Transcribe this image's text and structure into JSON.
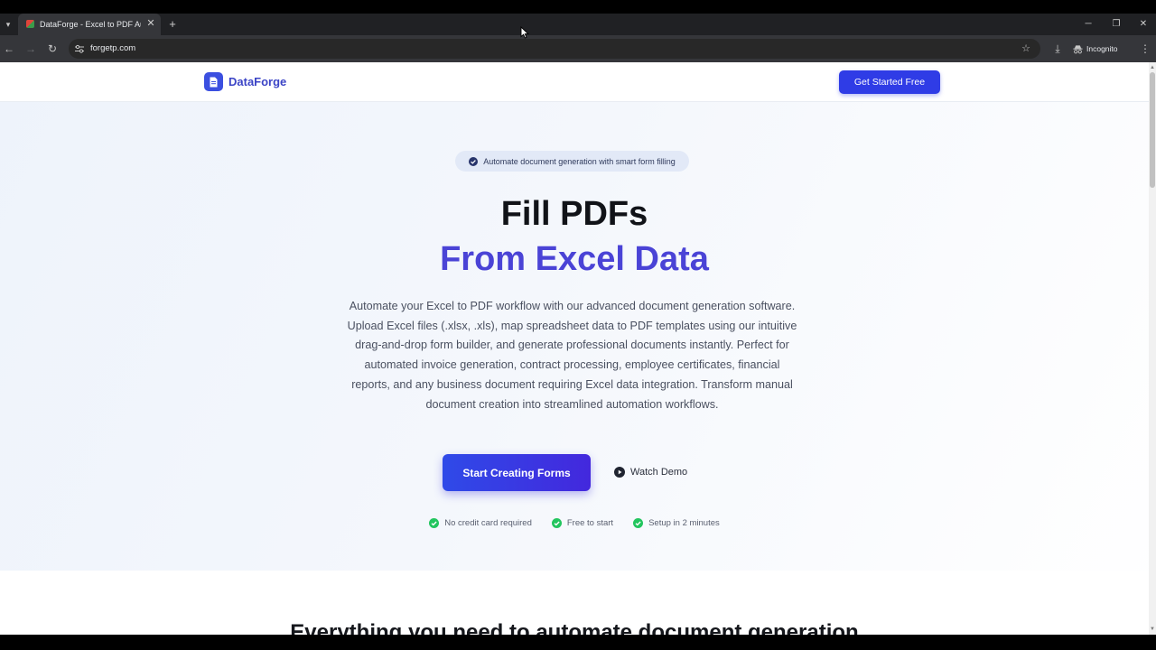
{
  "browser": {
    "tab": {
      "title": "DataForge - Excel to PDF Automation"
    },
    "url": "forgetp.com",
    "incognito_label": "Incognito"
  },
  "header": {
    "brand": "DataForge",
    "cta": "Get Started Free"
  },
  "hero": {
    "badge": "Automate document generation with smart form filling",
    "title_line1": "Fill PDFs",
    "title_line2": "From Excel Data",
    "description": "Automate your Excel to PDF workflow with our advanced document generation software. Upload Excel files (.xlsx, .xls), map spreadsheet data to PDF templates using our intuitive drag-and-drop form builder, and generate professional documents instantly. Perfect for automated invoice generation, contract processing, employee certificates, financial reports, and any business document requiring Excel data integration. Transform manual document creation into streamlined automation workflows.",
    "primary_button": "Start Creating Forms",
    "secondary_button": "Watch Demo",
    "checks": [
      "No credit card required",
      "Free to start",
      "Setup in 2 minutes"
    ]
  },
  "features": {
    "title": "Everything you need to automate document generation"
  },
  "colors": {
    "accent": "#3b4fe0",
    "headline_accent": "#4a43d6",
    "check_green": "#22c55e"
  }
}
